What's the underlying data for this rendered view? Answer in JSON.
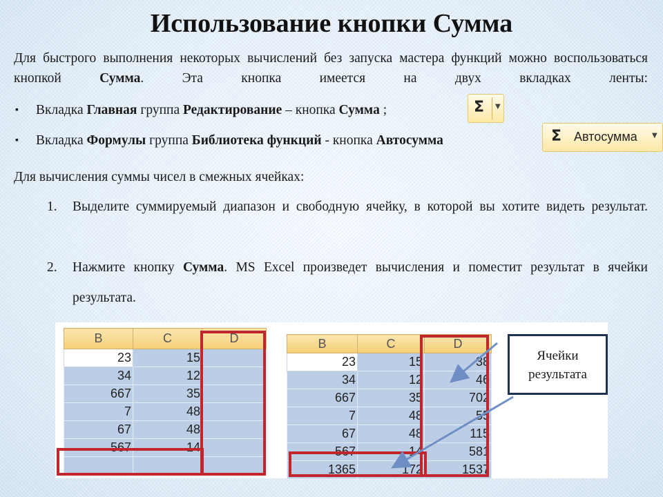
{
  "title": "Использование кнопки Сумма",
  "intro": {
    "text1": "Для быстрого выполнения некоторых вычислений без запуска мастера функций можно воспользоваться кнопкой ",
    "bold1": "Сумма",
    "text2": ". Эта кнопка имеется на двух вкладках ленты:"
  },
  "bullets": [
    {
      "mark": "▪",
      "t1": "Вкладка ",
      "b1": "Главная",
      "t2": " группа ",
      "b2": "Редактирование",
      "t3": " – кнопка ",
      "b3": "Сумма",
      "t4": " ;"
    },
    {
      "mark": "▪",
      "t1": "Вкладка ",
      "b1": "Формулы",
      "t2": " группа ",
      "b2": "Библиотека функций",
      "t3": " - кнопка ",
      "b3": "Автосумма",
      "t4": ""
    }
  ],
  "ribbon": {
    "sigma_symbol": "Σ",
    "dropdown_arrow": "▼",
    "autosum_label": "Автосумма"
  },
  "para2": "Для вычисления суммы чисел в смежных ячейках:",
  "steps": [
    {
      "num": "1.",
      "text": "Выделите суммируемый диапазон и свободную ячейку, в которой вы хотите видеть результат."
    },
    {
      "num": "2.",
      "t1": "Нажмите кнопку ",
      "b1": "Сумма",
      "t2": ". MS Excel произведет вычисления и поместит результат в ячейки результата."
    }
  ],
  "sheet_before": {
    "headers": [
      "B",
      "C",
      "D"
    ],
    "rows": [
      [
        "23",
        "15",
        ""
      ],
      [
        "34",
        "12",
        ""
      ],
      [
        "667",
        "35",
        ""
      ],
      [
        "7",
        "48",
        ""
      ],
      [
        "67",
        "48",
        ""
      ],
      [
        "567",
        "14",
        ""
      ],
      [
        "",
        "",
        ""
      ]
    ]
  },
  "sheet_after": {
    "headers": [
      "B",
      "C",
      "D"
    ],
    "rows": [
      [
        "23",
        "15",
        "38"
      ],
      [
        "34",
        "12",
        "46"
      ],
      [
        "667",
        "35",
        "702"
      ],
      [
        "7",
        "48",
        "55"
      ],
      [
        "67",
        "48",
        "115"
      ],
      [
        "567",
        "14",
        "581"
      ],
      [
        "1365",
        "172",
        "1537"
      ]
    ]
  },
  "callout": {
    "line1": "Ячейки",
    "line2": "результата"
  },
  "colors": {
    "highlight_red": "#c0262b",
    "selected_cell": "#bccde6",
    "header_gold": "#f5cf76",
    "callout_border": "#1f3350",
    "arrow_blue": "#6f8fc4"
  }
}
